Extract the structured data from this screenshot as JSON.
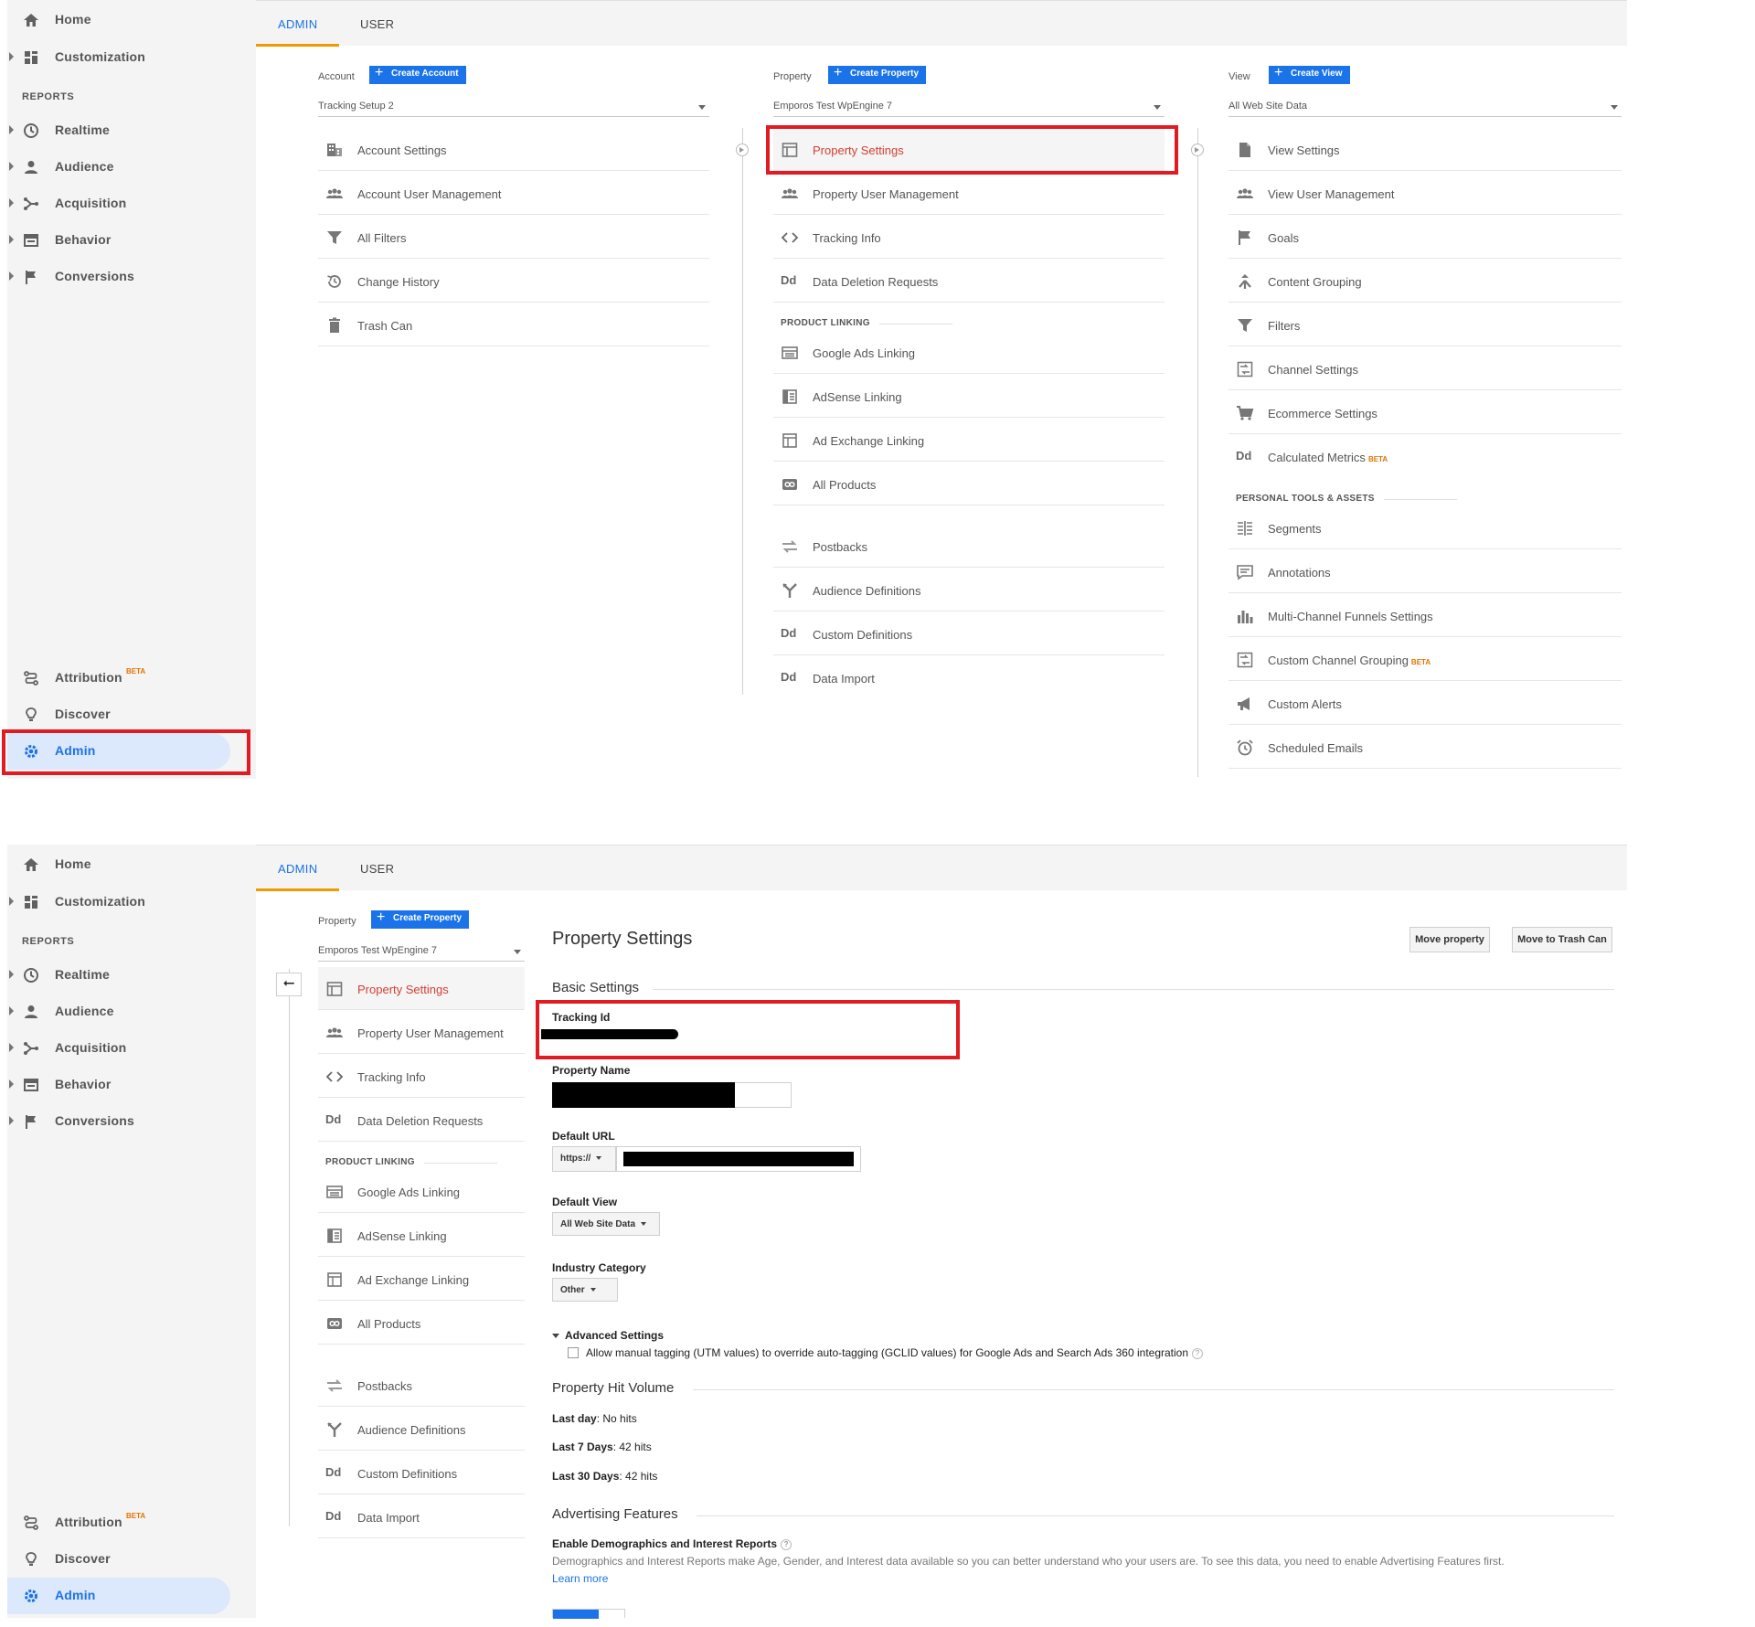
{
  "sidebar": {
    "home": "Home",
    "customization": "Customization",
    "reports_label": "REPORTS",
    "realtime": "Realtime",
    "audience": "Audience",
    "acquisition": "Acquisition",
    "behavior": "Behavior",
    "conversions": "Conversions",
    "attribution": "Attribution",
    "beta": "BETA",
    "discover": "Discover",
    "admin": "Admin"
  },
  "tabs": {
    "admin": "ADMIN",
    "user": "USER"
  },
  "colors": {
    "accent": "#1a73e8",
    "highlight": "#e11b22",
    "tab_underline": "#f29900",
    "beta": "#e37400",
    "active_item": "#d23f31"
  },
  "account": {
    "label": "Account",
    "create": "Create Account",
    "selected": "Tracking Setup 2",
    "items": [
      "Account Settings",
      "Account User Management",
      "All Filters",
      "Change History",
      "Trash Can"
    ]
  },
  "property": {
    "label": "Property",
    "create": "Create Property",
    "selected": "Emporos Test WpEngine 7",
    "items": [
      "Property Settings",
      "Property User Management",
      "Tracking Info",
      "Data Deletion Requests"
    ],
    "product_linking": "PRODUCT LINKING",
    "linking_items": [
      "Google Ads Linking",
      "AdSense Linking",
      "Ad Exchange Linking",
      "All Products"
    ],
    "more_items": [
      "Postbacks",
      "Audience Definitions",
      "Custom Definitions",
      "Data Import"
    ]
  },
  "view": {
    "label": "View",
    "create": "Create View",
    "selected": "All Web Site Data",
    "items": [
      "View Settings",
      "View User Management",
      "Goals",
      "Content Grouping",
      "Filters",
      "Channel Settings",
      "Ecommerce Settings",
      "Calculated Metrics"
    ],
    "personal_tools": "PERSONAL TOOLS & ASSETS",
    "personal_items": [
      "Segments",
      "Annotations",
      "Multi-Channel Funnels Settings",
      "Custom Channel Grouping",
      "Custom Alerts",
      "Scheduled Emails"
    ]
  },
  "icons": {
    "dd": "Dd",
    "back": "⭠"
  },
  "settings": {
    "title": "Property Settings",
    "move_property": "Move property",
    "move_trash": "Move to Trash Can",
    "basic_settings": "Basic Settings",
    "tracking_id_label": "Tracking Id",
    "property_name_label": "Property Name",
    "default_url_label": "Default URL",
    "protocol": "https://",
    "default_view_label": "Default View",
    "default_view_value": "All Web Site Data",
    "industry_label": "Industry Category",
    "industry_value": "Other",
    "advanced_settings": "Advanced Settings",
    "manual_tagging": "Allow manual tagging (UTM values) to override auto-tagging (GCLID values) for Google Ads and Search Ads 360 integration",
    "hit_volume_title": "Property Hit Volume",
    "last_day_label": "Last day",
    "last_day_value": ": No hits",
    "last7_label": "Last 7 Days",
    "last7_value": ": 42 hits",
    "last30_label": "Last 30 Days",
    "last30_value": ": 42 hits",
    "advertising_title": "Advertising Features",
    "demographics_label": "Enable Demographics and Interest Reports",
    "demographics_desc": "Demographics and Interest Reports make Age, Gender, and Interest data available so you can better understand who your users are. To see this data, you need to enable Advertising Features first.",
    "learn_more": "Learn more",
    "help": "?"
  }
}
